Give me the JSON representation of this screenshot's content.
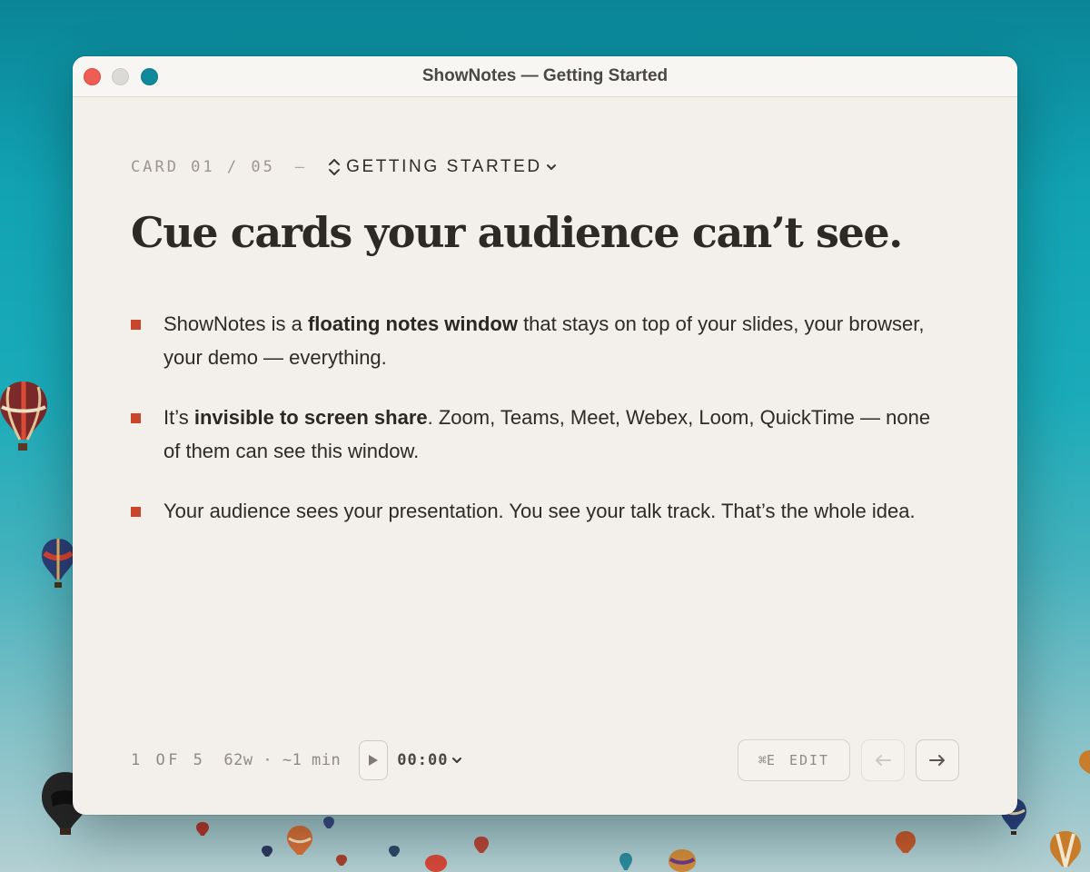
{
  "window": {
    "title": "ShowNotes — Getting Started"
  },
  "card": {
    "counter": "CARD 01 / 05",
    "separator": "—",
    "section_label": "GETTING STARTED",
    "headline": "Cue cards your audience can’t see.",
    "bullets": [
      {
        "before": "ShowNotes is a ",
        "bold": "floating notes window",
        "after": " that stays on top of your slides, your browser, your demo — everything."
      },
      {
        "before": "It’s ",
        "bold": "invisible to screen share",
        "after": ". Zoom, Teams, Meet, Webex, Loom, QuickTime — none of them can see this window."
      },
      {
        "before": "Your audience sees your presentation. You see your talk track. That’s the whole idea.",
        "bold": "",
        "after": ""
      }
    ]
  },
  "footer": {
    "position": "1 OF 5",
    "words": "62w · ~1 min",
    "timer": "00:00",
    "edit_shortcut": "⌘E",
    "edit_label": "EDIT"
  },
  "icons": {
    "play": "play-icon",
    "prev": "arrow-left-icon",
    "next": "arrow-right-icon",
    "section_picker": "chevron-up-down-icon",
    "dropdown": "chevron-down-icon"
  },
  "colors": {
    "accent_bullet": "#c8472c",
    "close": "#ef5d57",
    "zoom": "#10899a",
    "window_bg": "#f3efea"
  }
}
